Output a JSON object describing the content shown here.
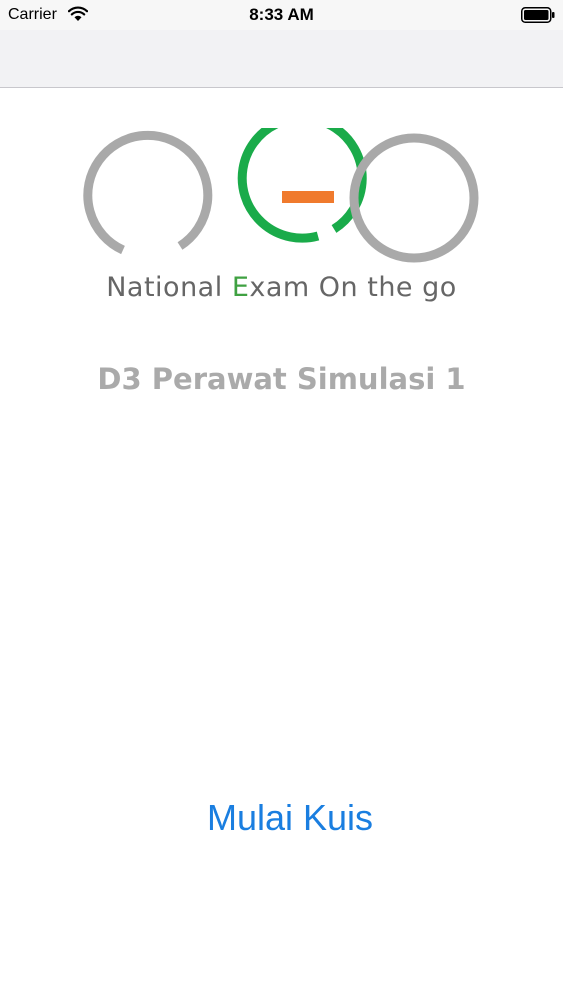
{
  "status_bar": {
    "carrier": "Carrier",
    "time": "8:33 AM",
    "icons": [
      "wifi-icon",
      "battery-icon"
    ]
  },
  "logo": {
    "letters": [
      "n",
      "e",
      "o"
    ],
    "tagline_prefix": "National ",
    "tagline_highlight": "E",
    "tagline_suffix": "xam On the go",
    "colors": {
      "gray": "#a9a9a9",
      "green": "#1aab4a",
      "orange": "#f07a2d"
    }
  },
  "main": {
    "subtitle": "D3 Perawat Simulasi 1",
    "start_label": "Mulai Kuis",
    "accent_color": "#1a7ee0"
  }
}
